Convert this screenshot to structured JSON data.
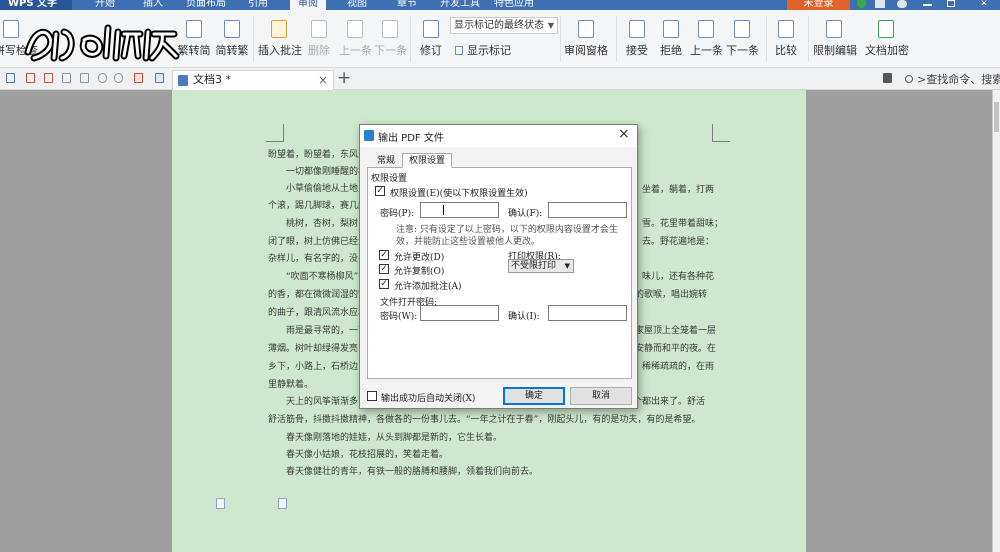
{
  "menubar": {
    "app_name": "WPS 文字",
    "items": [
      "开始",
      "插入",
      "页面布局",
      "引用",
      "审阅",
      "视图",
      "章节",
      "开发工具",
      "特色应用"
    ],
    "active": "审阅",
    "login": "未登录"
  },
  "ribbon": {
    "spell_check": "拼写检查",
    "trad_to_simp": "繁转简",
    "simp_to_trad": "简转繁",
    "insert_comment": "插入批注",
    "delete": "删除",
    "prev": "上一条",
    "next": "下一条",
    "revise": "修订",
    "markup_state": "显示标记的最终状态",
    "show_markup": "显示标记",
    "review_pane": "审阅窗格",
    "accept": "接受",
    "reject": "拒绝",
    "prev2": "上一条",
    "next2": "下一条",
    "compare": "比较",
    "restrict_edit": "限制编辑",
    "doc_encrypt": "文档加密"
  },
  "tabbar": {
    "doc_tab": "文档3 *",
    "close": "×",
    "plus": "+",
    "search": ">查找命令、搜索..."
  },
  "watermark": {
    "text": "秒懂视频"
  },
  "document": {
    "lines": [
      {
        "t": "盼望着，盼望着，东风来"
      },
      {
        "t": "一切都像刚睡醒的样"
      },
      {
        "t": "小草偷偷地从土地里"
      },
      {
        "t": "个滚，踢几脚球，赛几趟"
      },
      {
        "t": "桃树，杏树，梨树，"
      },
      {
        "t": "闭了眼，树上仿佛已经满"
      },
      {
        "t": "杂样儿，有名字的，没名"
      },
      {
        "t": "“吹面不寒杨柳风”"
      },
      {
        "t": "的香，都在微微润湿的空"
      },
      {
        "t": "的曲子，跟清风流水应和"
      },
      {
        "t": "雨是最寻常的，一下"
      },
      {
        "t": "薄烟。树叶却绿得发亮，"
      },
      {
        "t": "乡下，小路上，石桥边，"
      },
      {
        "t": "里静默着。"
      },
      {
        "t": "天上的风筝渐渐多了"
      },
      {
        "t": "舒活筋骨，抖擞抖擞精神，各做各的一份事儿去。“一年之计在于春”，刚起头儿，有的是功夫，有的是希望。"
      },
      {
        "t": "春天像刚落地的娃娃，从头到脚都是新的，它生长着。"
      },
      {
        "t": "春天像小姑娘，花枝招展的，笑着走着。"
      },
      {
        "t": "春天像健壮的青年，有铁一般的胳膊和腰脚，领着我们向前去。"
      }
    ],
    "right_fragments": [
      {
        "t": "坐着，躺着，打两"
      },
      {
        "t": "雪。花里带着甜味；"
      },
      {
        "t": "去。野花遍地是："
      },
      {
        "t": "味儿，还有各种花"
      },
      {
        "t": "的歌喉，唱出婉转"
      },
      {
        "t": "家屋顶上全笼着一层"
      },
      {
        "t": "安静而和平的夜。在"
      },
      {
        "t": "稀稀疏疏的，在雨"
      },
      {
        "t": "个都出来了。舒活"
      }
    ]
  },
  "dialog": {
    "title": "输出 PDF 文件",
    "close": "×",
    "tabs": [
      "常规",
      "权限设置"
    ],
    "active_tab": "权限设置",
    "section": "权限设置",
    "enable_permissions": "权限设置(E)(使以下权限设置生效)",
    "password_label": "密码(P):",
    "confirm_label": "确认(F):",
    "note": "注意: 只有设定了以上密码，以下的权限内容设置才会生效，并能防止这些设置被他人更改。",
    "allow_modify": "允许更改(D)",
    "allow_copy": "允许复制(O)",
    "allow_annotate": "允许添加批注(A)",
    "print_label": "打印权限(R):",
    "print_value": "不受限打印",
    "open_password_section": "文件打开密码:",
    "open_password_label": "密码(W):",
    "open_confirm_label": "确认(I):",
    "auto_close": "输出成功后自动关闭(X)",
    "ok": "确定",
    "cancel": "取消",
    "check_enable": true,
    "check_modify": true,
    "check_copy": true,
    "check_annotate": true,
    "check_autoclose": false
  },
  "colors": {
    "page_bg": "#cde8cd",
    "title_blue": "#3e6fb3",
    "login_orange": "#e0642a",
    "dialog_accent": "#0078d7"
  }
}
